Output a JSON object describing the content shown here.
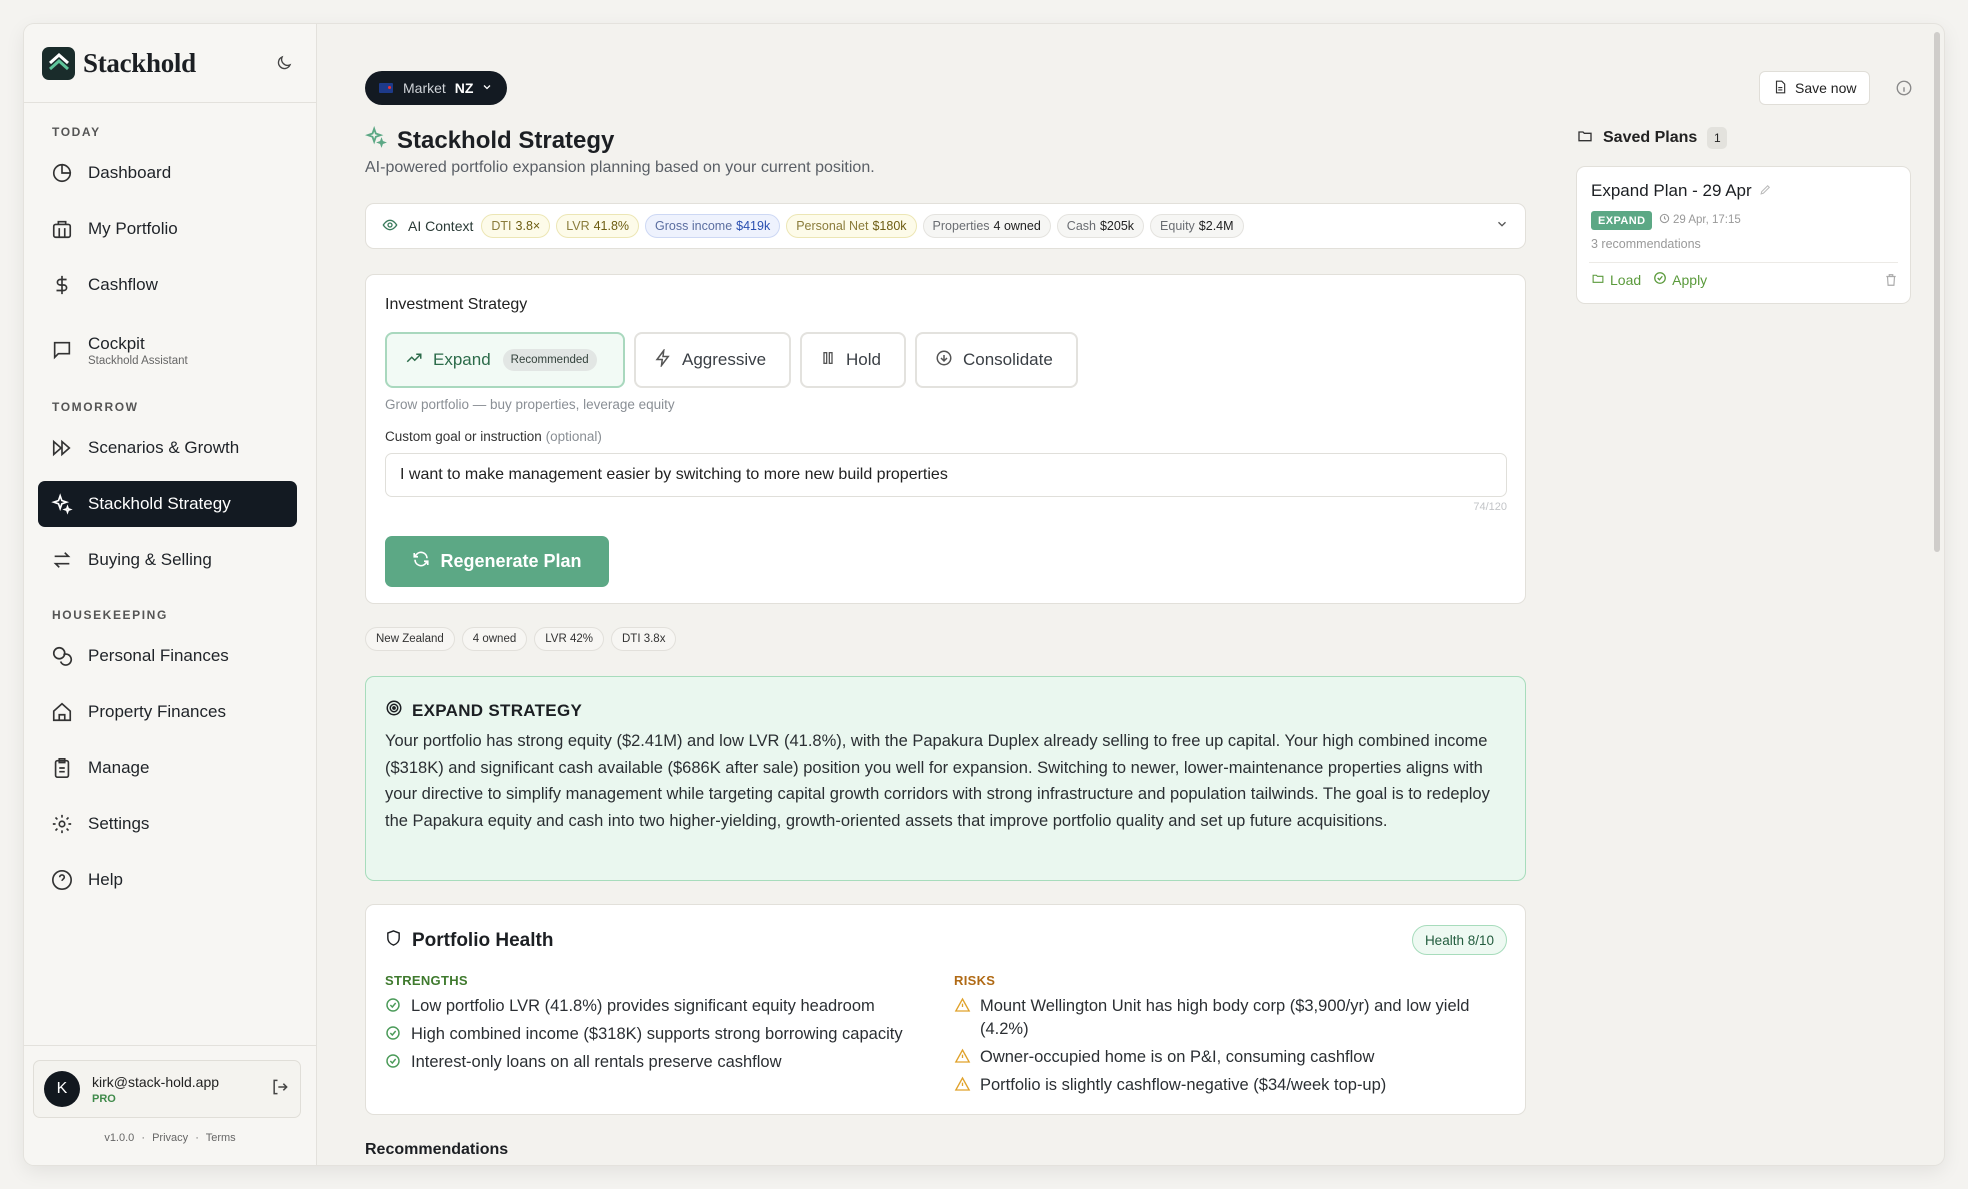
{
  "brand": {
    "name": "Stackhold"
  },
  "sidebar": {
    "sections": {
      "today": "TODAY",
      "tomorrow": "TOMORROW",
      "housekeeping": "HOUSEKEEPING"
    },
    "items": [
      {
        "label": "Dashboard",
        "icon": "pie-chart-icon"
      },
      {
        "label": "My Portfolio",
        "icon": "building-icon"
      },
      {
        "label": "Cashflow",
        "icon": "dollar-icon"
      },
      {
        "label": "Cockpit",
        "sub": "Stackhold Assistant",
        "icon": "chat-icon"
      },
      {
        "label": "Scenarios & Growth",
        "icon": "fast-forward-icon"
      },
      {
        "label": "Stackhold Strategy",
        "icon": "sparkles-icon",
        "active": true
      },
      {
        "label": "Buying & Selling",
        "icon": "swap-icon"
      },
      {
        "label": "Personal Finances",
        "icon": "coins-icon"
      },
      {
        "label": "Property Finances",
        "icon": "home-icon"
      },
      {
        "label": "Manage",
        "icon": "clipboard-icon"
      },
      {
        "label": "Settings",
        "icon": "gear-icon"
      },
      {
        "label": "Help",
        "icon": "help-icon"
      }
    ]
  },
  "user": {
    "initial": "K",
    "email": "kirk@stack-hold.app",
    "plan": "PRO"
  },
  "footer": {
    "version": "v1.0.0",
    "privacy": "Privacy",
    "terms": "Terms",
    "sep": "·"
  },
  "header": {
    "market_label": "Market",
    "market_value": "NZ",
    "title": "Stackhold Strategy",
    "subtitle": "AI-powered portfolio expansion planning based on your current position.",
    "save_label": "Save now"
  },
  "context": {
    "label": "AI Context",
    "chips": [
      {
        "k": "DTI",
        "v": "3.8×"
      },
      {
        "k": "LVR",
        "v": "41.8%"
      },
      {
        "k": "Gross income",
        "v": "$419k"
      },
      {
        "k": "Personal Net",
        "v": "$180k"
      },
      {
        "k": "Properties",
        "v": "4 owned"
      },
      {
        "k": "Cash",
        "v": "$205k"
      },
      {
        "k": "Equity",
        "v": "$2.4M"
      }
    ]
  },
  "strategy": {
    "label": "Investment Strategy",
    "options": [
      {
        "label": "Expand",
        "tag": "Recommended"
      },
      {
        "label": "Aggressive"
      },
      {
        "label": "Hold"
      },
      {
        "label": "Consolidate"
      }
    ],
    "hint": "Grow portfolio — buy properties, leverage equity",
    "goal_label": "Custom goal or instruction",
    "goal_optional": "(optional)",
    "goal_value": "I want to make management easier by switching to more new build properties",
    "counter": "74/120",
    "regen_label": "Regenerate Plan"
  },
  "mini_chips": [
    "New Zealand",
    "4 owned",
    "LVR 42%",
    "DTI 3.8x"
  ],
  "expand": {
    "title": "EXPAND STRATEGY",
    "text": "Your portfolio has strong equity ($2.41M) and low LVR (41.8%), with the Papakura Duplex already selling to free up capital. Your high combined income ($318K) and significant cash available ($686K after sale) position you well for expansion. Switching to newer, lower-maintenance properties aligns with your directive to simplify management while targeting capital growth corridors with strong infrastructure and population tailwinds. The goal is to redeploy the Papakura equity and cash into two higher-yielding, growth-oriented assets that improve portfolio quality and set up future acquisitions."
  },
  "health": {
    "title": "Portfolio Health",
    "badge": "Health 8/10",
    "strengths_label": "STRENGTHS",
    "risks_label": "RISKS",
    "strengths": [
      "Low portfolio LVR (41.8%) provides significant equity headroom",
      "High combined income ($318K) supports strong borrowing capacity",
      "Interest-only loans on all rentals preserve cashflow"
    ],
    "risks": [
      "Mount Wellington Unit has high body corp ($3,900/yr) and low yield (4.2%)",
      "Owner-occupied home is on P&I, consuming cashflow",
      "Portfolio is slightly cashflow-negative ($34/week top-up)"
    ]
  },
  "recommendations_label": "Recommendations",
  "saved": {
    "title": "Saved Plans",
    "count": "1",
    "plan": {
      "name": "Expand Plan - 29 Apr",
      "tag": "EXPAND",
      "date": "29 Apr, 17:15",
      "recs": "3 recommendations",
      "load": "Load",
      "apply": "Apply"
    }
  },
  "colors": {
    "accent": "#5ca885",
    "dark": "#131a22",
    "success_bg": "#eaf7ef"
  }
}
